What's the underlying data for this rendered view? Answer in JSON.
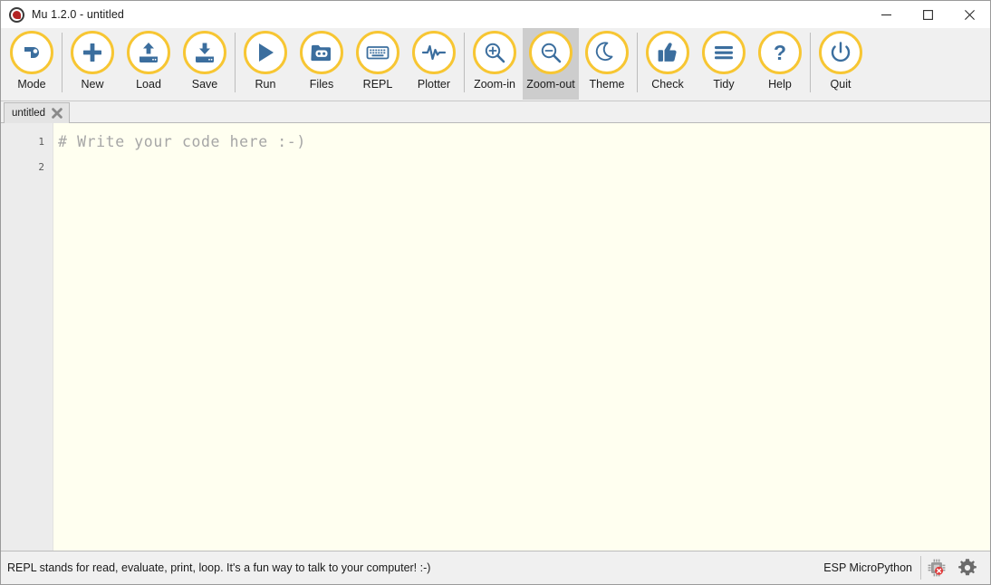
{
  "window": {
    "title": "Mu 1.2.0 - untitled",
    "logo_icon": "mu-logo-icon",
    "controls": {
      "minimize": "minimize-icon",
      "maximize": "maximize-icon",
      "close": "close-icon"
    }
  },
  "toolbar": {
    "accent_color": "#f7c633",
    "icon_color": "#3b6e9e",
    "active_bg": "#cdcdcd",
    "items": [
      {
        "label": "Mode",
        "icon": "mode-icon",
        "active": false,
        "sep_after": true
      },
      {
        "label": "New",
        "icon": "new-icon",
        "active": false,
        "sep_after": false
      },
      {
        "label": "Load",
        "icon": "load-icon",
        "active": false,
        "sep_after": false
      },
      {
        "label": "Save",
        "icon": "save-icon",
        "active": false,
        "sep_after": true
      },
      {
        "label": "Run",
        "icon": "run-icon",
        "active": false,
        "sep_after": false
      },
      {
        "label": "Files",
        "icon": "files-icon",
        "active": false,
        "sep_after": false
      },
      {
        "label": "REPL",
        "icon": "repl-icon",
        "active": false,
        "sep_after": false
      },
      {
        "label": "Plotter",
        "icon": "plotter-icon",
        "active": false,
        "sep_after": true
      },
      {
        "label": "Zoom-in",
        "icon": "zoom-in-icon",
        "active": false,
        "sep_after": false
      },
      {
        "label": "Zoom-out",
        "icon": "zoom-out-icon",
        "active": true,
        "sep_after": false
      },
      {
        "label": "Theme",
        "icon": "theme-icon",
        "active": false,
        "sep_after": true
      },
      {
        "label": "Check",
        "icon": "check-icon",
        "active": false,
        "sep_after": false
      },
      {
        "label": "Tidy",
        "icon": "tidy-icon",
        "active": false,
        "sep_after": false
      },
      {
        "label": "Help",
        "icon": "help-icon",
        "active": false,
        "sep_after": true
      },
      {
        "label": "Quit",
        "icon": "quit-icon",
        "active": false,
        "sep_after": false
      }
    ]
  },
  "tabs": [
    {
      "label": "untitled",
      "close_icon": "close-icon",
      "active": true
    }
  ],
  "editor": {
    "background": "#fffff0",
    "gutter_background": "#ececec",
    "comment_color": "#a6a6a6",
    "line_numbers": [
      "1",
      "2"
    ],
    "lines": [
      "# Write your code here :-)",
      ""
    ]
  },
  "statusbar": {
    "message": "REPL stands for read, evaluate, print, loop. It's a fun way to talk to your computer! :-)",
    "mode_label": "ESP MicroPython",
    "device_icon": "microchip-disconnected-icon",
    "settings_icon": "gear-icon"
  }
}
